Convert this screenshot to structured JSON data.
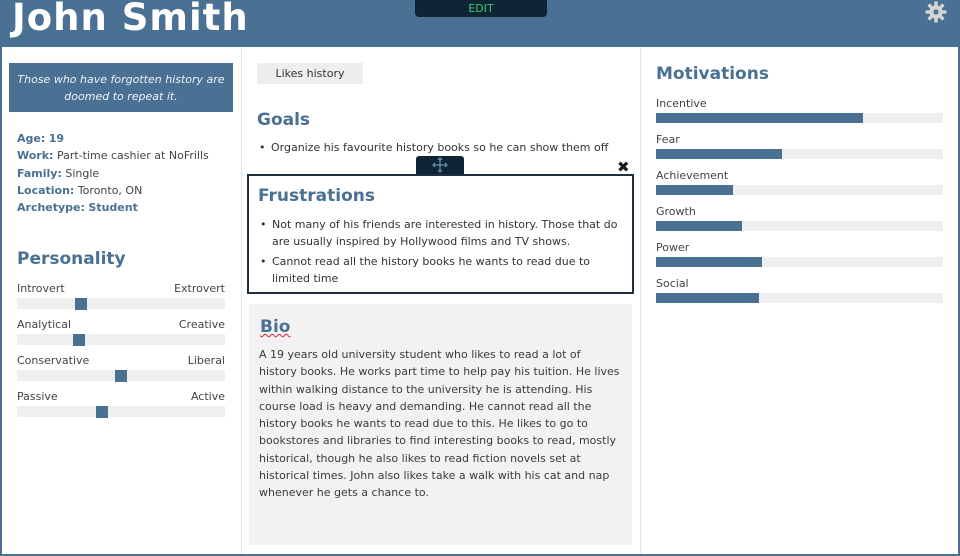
{
  "persona": {
    "name": "John Smith",
    "edit_label": "EDIT",
    "quote": "Those who have forgotten history are doomed to repeat it.",
    "info": [
      {
        "key": "Age:",
        "value": "19"
      },
      {
        "key": "Work:",
        "value": "Part-time cashier at NoFrills"
      },
      {
        "key": "Family:",
        "value": "Single"
      },
      {
        "key": "Location:",
        "value": "Toronto, ON"
      },
      {
        "key": "Archetype:",
        "value": "Student"
      }
    ]
  },
  "personality": {
    "title": "Personality",
    "sliders": [
      {
        "left": "Introvert",
        "right": "Extrovert",
        "value": 0.31
      },
      {
        "left": "Analytical",
        "right": "Creative",
        "value": 0.3
      },
      {
        "left": "Conservative",
        "right": "Liberal",
        "value": 0.5
      },
      {
        "left": "Passive",
        "right": "Active",
        "value": 0.41
      }
    ]
  },
  "middle": {
    "tag": "Likes history",
    "goals_title": "Goals",
    "goals": [
      "Organize his favourite history books so he can show them off"
    ],
    "frustrations_title": "Frustrations",
    "frustrations": [
      "Not many of his friends are interested in history. Those that do are usually inspired by Hollywood films and TV shows.",
      "Cannot read all the history books he wants to read due to limited time"
    ],
    "bio_title": "Bio",
    "bio_text": "A 19 years old university student who likes to read a lot of history books. He works part time to help pay his tuition. He lives within walking distance to the university he is attending. His course load is heavy and demanding. He cannot read all the history books he wants to read due to this. He likes to go to bookstores and libraries to find interesting books to read, mostly historical, though he also likes to read fiction novels set at historical times. John also likes take a walk with his cat and nap whenever he gets a chance to."
  },
  "motivations": {
    "title": "Motivations",
    "items": [
      {
        "label": "Incentive",
        "value": 0.72
      },
      {
        "label": "Fear",
        "value": 0.44
      },
      {
        "label": "Achievement",
        "value": 0.27
      },
      {
        "label": "Growth",
        "value": 0.3
      },
      {
        "label": "Power",
        "value": 0.37
      },
      {
        "label": "Social",
        "value": 0.36
      }
    ]
  },
  "icons": {
    "gear": "gear-icon",
    "move": "move-icon",
    "close": "close-icon"
  },
  "colors": {
    "accent": "#4a7094",
    "dark": "#0f2536",
    "edit_text": "#3fc86e"
  }
}
